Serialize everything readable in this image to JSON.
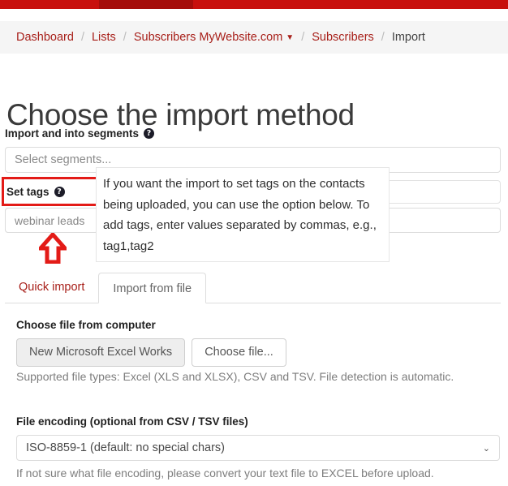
{
  "topbar": {
    "color": "#c8100d",
    "active_tab_color": "#a50d0a"
  },
  "breadcrumb": {
    "separator": "/",
    "items": [
      {
        "label": "Dashboard",
        "current": false,
        "caret": ""
      },
      {
        "label": "Lists",
        "current": false,
        "caret": ""
      },
      {
        "label": "Subscribers MyWebsite.com",
        "current": false,
        "caret": "▼"
      },
      {
        "label": "Subscribers",
        "current": false,
        "caret": ""
      },
      {
        "label": "Import",
        "current": true,
        "caret": ""
      }
    ]
  },
  "page": {
    "title": "Choose the import method"
  },
  "segments": {
    "label": "Import and into segments",
    "help_icon": "?",
    "placeholder": "Select segments...",
    "value": ""
  },
  "tags": {
    "label": "Set tags",
    "help_icon": "?",
    "value": "webinar leads",
    "highlight_color": "#e31b17",
    "tooltip": "If you want the import to set tags on the contacts being uploaded, you can use the option below. To add tags, enter values separated by commas, e.g., tag1,tag2"
  },
  "annotation": {
    "arrow": "up-arrow",
    "color": "#e31b17"
  },
  "tabs": [
    {
      "label": "Quick import",
      "active": false
    },
    {
      "label": "Import from file",
      "active": true
    }
  ],
  "file_chooser": {
    "label": "Choose file from computer",
    "file_name": "New Microsoft Excel Works",
    "button_label": "Choose file...",
    "help_text": "Supported file types: Excel (XLS and XLSX), CSV and TSV. File detection is automatic."
  },
  "encoding": {
    "label": "File encoding (optional from CSV / TSV files)",
    "selected": "ISO-8859-1 (default: no special chars)",
    "caret": "⌄",
    "help_text": "If not sure what file encoding, please convert your text file to EXCEL before upload."
  }
}
